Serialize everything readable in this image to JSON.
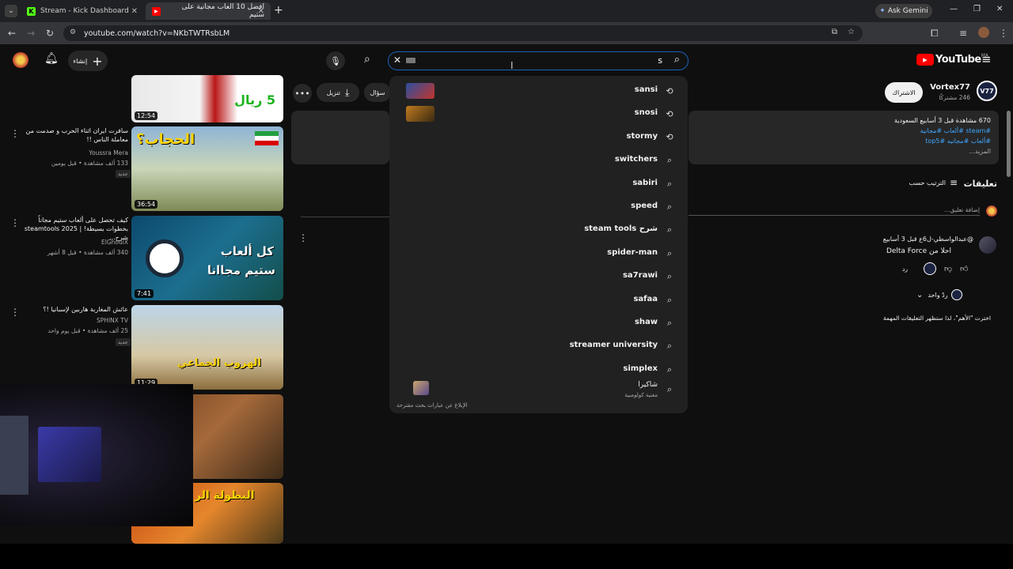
{
  "browser": {
    "tabs": [
      {
        "title": "Stream - Kick Dashboard",
        "active": false
      },
      {
        "title": "افضل 10 العاب مجانية على ستيم",
        "active": true
      }
    ],
    "new_tab": "+",
    "ask_gemini": "Ask Gemini",
    "url": "youtube.com/watch?v=NKbTWTRsbLM"
  },
  "youtube": {
    "logo_text": "YouTube",
    "logo_sup": "MA",
    "create_label": "إنشاء",
    "search_value": "s",
    "suggestions": [
      {
        "text": "sansi",
        "kind": "history",
        "has_thumb": true
      },
      {
        "text": "snosi",
        "kind": "history",
        "has_thumb": true
      },
      {
        "text": "stormy",
        "kind": "history",
        "has_thumb": false
      },
      {
        "text": "switchers",
        "kind": "search",
        "has_thumb": false
      },
      {
        "text": "sabiri",
        "kind": "search",
        "has_thumb": false
      },
      {
        "text": "speed",
        "kind": "search",
        "has_thumb": false
      },
      {
        "text": "steam tools شرح",
        "kind": "search",
        "has_thumb": false
      },
      {
        "text": "spider-man",
        "kind": "search",
        "has_thumb": false
      },
      {
        "text": "sa7rawi",
        "kind": "search",
        "has_thumb": false
      },
      {
        "text": "safaa",
        "kind": "search",
        "has_thumb": false
      },
      {
        "text": "shaw",
        "kind": "search",
        "has_thumb": false
      },
      {
        "text": "streamer university",
        "kind": "search",
        "has_thumb": false
      },
      {
        "text": "simplex",
        "kind": "search",
        "has_thumb": false
      }
    ],
    "last_suggestion": {
      "title": "شاكيرا",
      "subtitle": "مغنية كولومبية"
    },
    "report_link": "الإبلاغ عن عبارات بحث مقترحة",
    "channel": {
      "name": "Vortex77",
      "subs": "246 مشتركًا",
      "subscribe": "الاشتراك",
      "avatar": "V77"
    },
    "actions": {
      "download": "تنزيل",
      "ask": "سؤال"
    },
    "description": {
      "line1": "670 مشاهدة قبل 3 أسابيع السعودية",
      "tags1": "#steam #ألعاب #مجانية",
      "tags2": "#ألعاب #مجانيه #top5",
      "more": "المزيد..."
    },
    "comments": {
      "header": "تعليقات",
      "sort": "الترتيب حسب",
      "add_placeholder": "إضافة تعليق...",
      "author": "@عبدالواسطي-ل6ع قبل 3 أسابيع",
      "text": "احلا من Delta Force",
      "reply": "رد",
      "replies": "ردّ واحد",
      "pinned_note": "اخترت \"الأهم\"، لذا ستظهر التعليقات المهمة"
    },
    "videos": [
      {
        "title": "",
        "channel": "",
        "meta": "",
        "duration": "12:54"
      },
      {
        "title": "سافرت ايران اثناء الحرب و صدمت من معاملة الناس !!",
        "channel": "Youssra Mera",
        "meta": "133 ألف مشاهدة • قبل يومين",
        "badge": "جديد",
        "duration": "36:54"
      },
      {
        "title": "كيف تحصل على ألعاب ستيم مجاناً بخطوات بسيطة! | steamtools 2025 شرح...",
        "channel": "ElGhoulX",
        "meta": "340 ألف مشاهدة • قبل 8 أشهر",
        "duration": "7:41"
      },
      {
        "title": "عائش المغاربة هاربين لإسبانيا !؟",
        "channel": "SPHINX TV",
        "meta": "25 ألف مشاهدة • قبل يوم واحد",
        "badge": "جديد",
        "duration": "11:29"
      }
    ],
    "thumb_texts": {
      "t1": "5 ريال",
      "t2": "الحجاب؟",
      "t3a": "كل ألعاب",
      "t3b": "ستيم مجاانا",
      "t4": "الهروب الجماعي",
      "t6": "البطولة الر"
    }
  },
  "colors": {
    "accent": "#1c62b9",
    "yt_red": "#ff0000",
    "bg": "#0f0f0f",
    "link": "#3ea6ff"
  }
}
